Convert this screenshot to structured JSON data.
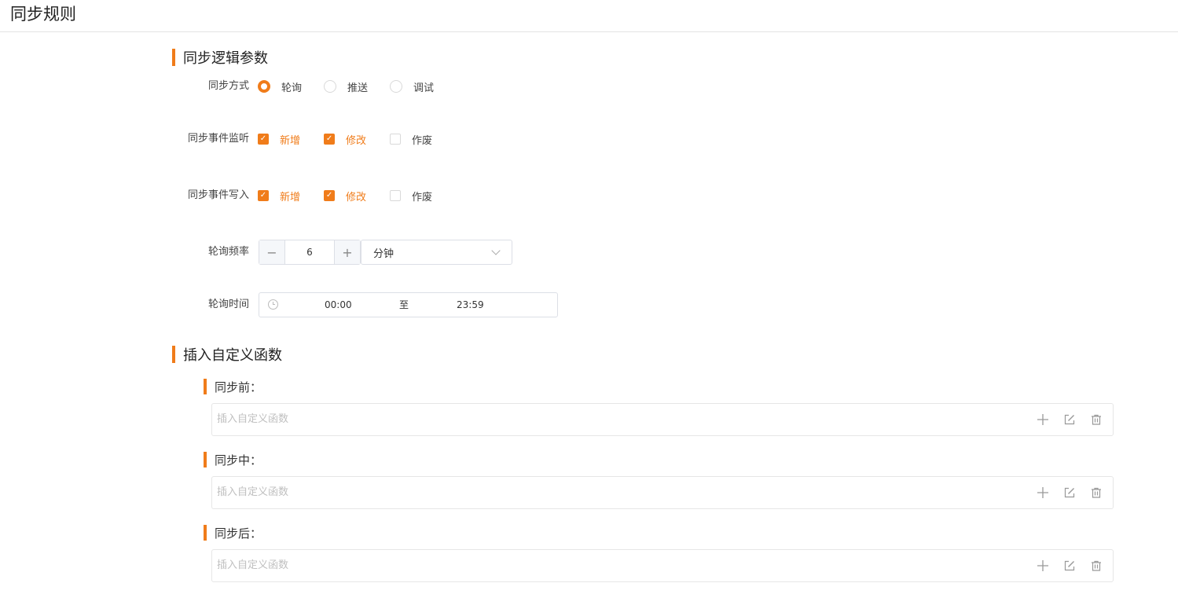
{
  "page": {
    "title": "同步规则"
  },
  "sections": {
    "logic": {
      "title": "同步逻辑参数"
    },
    "custom": {
      "title": "插入自定义函数"
    }
  },
  "sync_mode": {
    "label": "同步方式",
    "options": [
      {
        "label": "轮询",
        "checked": true
      },
      {
        "label": "推送",
        "checked": false
      },
      {
        "label": "调试",
        "checked": false
      }
    ]
  },
  "event_listen": {
    "label": "同步事件监听",
    "options": [
      {
        "label": "新增",
        "checked": true
      },
      {
        "label": "修改",
        "checked": true
      },
      {
        "label": "作废",
        "checked": false
      }
    ]
  },
  "event_write": {
    "label": "同步事件写入",
    "options": [
      {
        "label": "新增",
        "checked": true
      },
      {
        "label": "修改",
        "checked": true
      },
      {
        "label": "作废",
        "checked": false
      }
    ]
  },
  "poll_frequency": {
    "label": "轮询频率",
    "value": "6",
    "minus": "−",
    "plus": "+",
    "unit": "分钟"
  },
  "poll_time": {
    "label": "轮询时间",
    "start": "00:00",
    "separator": "至",
    "end": "23:59"
  },
  "functions": [
    {
      "label": "同步前：",
      "placeholder": "插入自定义函数"
    },
    {
      "label": "同步中：",
      "placeholder": "插入自定义函数"
    },
    {
      "label": "同步后：",
      "placeholder": "插入自定义函数"
    }
  ],
  "colors": {
    "accent": "#f07c1a",
    "border": "#dcdfe6",
    "placeholder": "#c0c0c0"
  }
}
